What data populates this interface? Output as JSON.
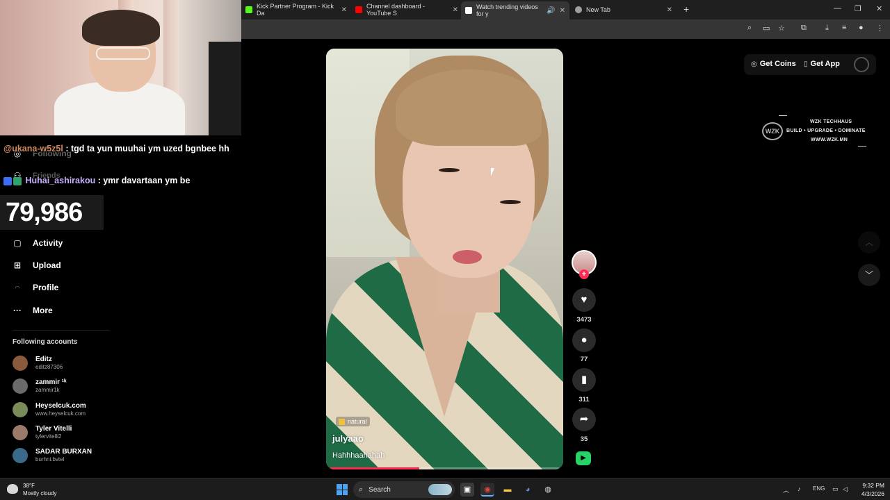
{
  "browser": {
    "tabs": [
      {
        "title": "Kick Partner Program - Kick Da",
        "favicon_color": "#53fc18"
      },
      {
        "title": "Channel dashboard - YouTube S",
        "favicon_color": "#ff0000"
      },
      {
        "title": "Watch trending videos for y",
        "favicon_color": "#ffffff"
      },
      {
        "title": "New Tab",
        "favicon_color": "#9aa0a6"
      }
    ],
    "new_tab_symbol": "+",
    "window_controls": [
      "—",
      "❐",
      "✕"
    ]
  },
  "stream_overlay": {
    "chat": [
      {
        "user": "@ukana-w5z5l",
        "message": ": tgd ta yun muuhai ym uzed bgnbee hh"
      },
      {
        "user": "Huhai_ashirakou",
        "message": ": ymr davartaan ym be"
      }
    ],
    "counter": "79,986"
  },
  "sidebar": {
    "hidden_items": [
      "Following",
      "Friends"
    ],
    "items": [
      {
        "label": "Activity",
        "icon": "activity-icon"
      },
      {
        "label": "Upload",
        "icon": "upload-icon"
      },
      {
        "label": "Profile",
        "icon": "profile-icon"
      },
      {
        "label": "More",
        "icon": "more-icon"
      }
    ],
    "following_title": "Following accounts",
    "accounts": [
      {
        "name": "Editz",
        "handle": "editz87306",
        "color": "#8b5a3c"
      },
      {
        "name": "zammir ¹ᵏ",
        "handle": "zammir1k",
        "color": "#6a6a6a"
      },
      {
        "name": "Heyselcuk.com",
        "handle": "www.heyselcuk.com",
        "color": "#7a8b5a"
      },
      {
        "name": "Tyler Vitelli",
        "handle": "tylervitelli2",
        "color": "#9a7a6a"
      },
      {
        "name": "SADAR BURXAN",
        "handle": "burhni.bvtel",
        "color": "#3a6a8a"
      }
    ]
  },
  "header": {
    "get_coins": "Get Coins",
    "get_app": "Get App"
  },
  "watermark": {
    "line1": "WZK TECHHAUS",
    "line2": "BUILD • UPGRADE • DOMINATE",
    "line3": "WWW.WZK.MN",
    "logo": "WZK"
  },
  "video": {
    "tag": "natural",
    "author": "julyaao",
    "caption": "Hahhhaahahah",
    "progress": 0.39
  },
  "actions": {
    "likes": "3473",
    "comments": "77",
    "saves": "311",
    "shares": "35"
  },
  "taskbar": {
    "temperature": "38°F",
    "weather": "Mostly cloudy",
    "search_label": "Search",
    "language": "ENG",
    "time": "9:32 PM",
    "date": "4/3/2026"
  }
}
